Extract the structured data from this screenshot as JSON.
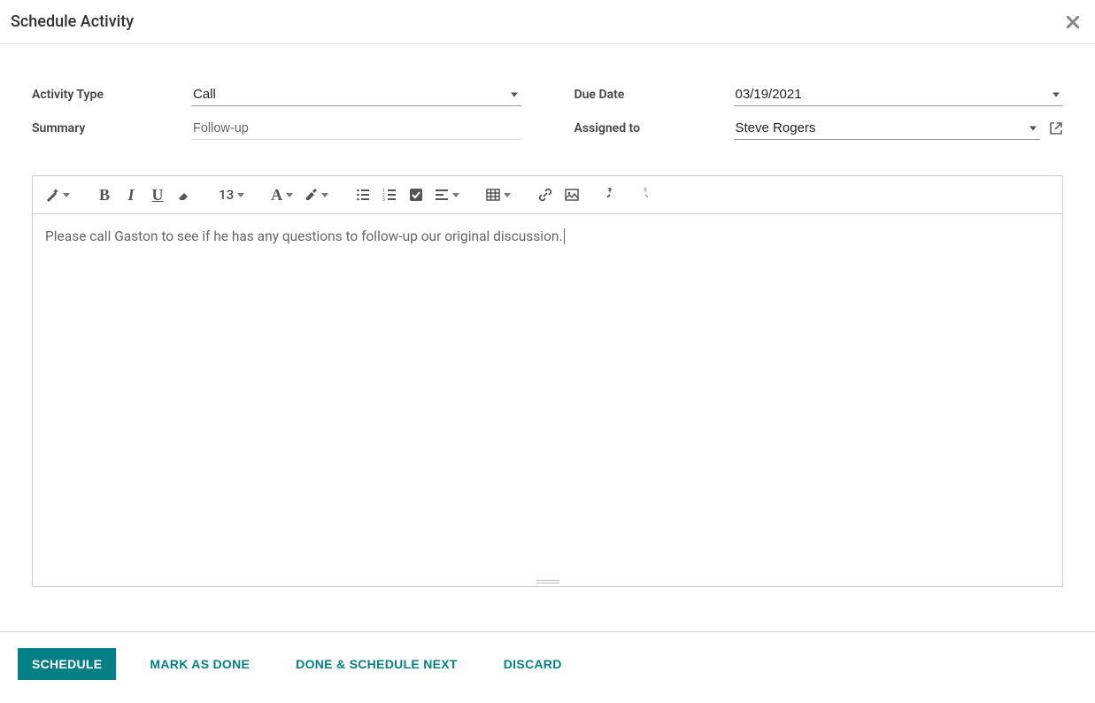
{
  "modal": {
    "title": "Schedule Activity"
  },
  "form": {
    "activity_type_label": "Activity Type",
    "activity_type_value": "Call",
    "summary_label": "Summary",
    "summary_value": "Follow-up",
    "due_date_label": "Due Date",
    "due_date_value": "03/19/2021",
    "assigned_to_label": "Assigned to",
    "assigned_to_value": "Steve Rogers"
  },
  "editor": {
    "font_size": "13",
    "content": "Please call Gaston to see if he has any questions to follow-up our original discussion."
  },
  "footer": {
    "schedule": "SCHEDULE",
    "mark_done": "MARK AS DONE",
    "done_next": "DONE & SCHEDULE NEXT",
    "discard": "DISCARD"
  },
  "icons": {
    "magic": "magic-wand-icon",
    "bold": "bold-icon",
    "italic": "italic-icon",
    "underline": "underline-icon",
    "eraser": "eraser-icon",
    "font": "font-icon",
    "highlight": "highlight-icon",
    "ul": "unordered-list-icon",
    "ol": "ordered-list-icon",
    "check": "checklist-icon",
    "align": "align-icon",
    "table": "table-icon",
    "link": "link-icon",
    "image": "image-icon",
    "undo": "undo-icon",
    "redo": "redo-icon"
  }
}
